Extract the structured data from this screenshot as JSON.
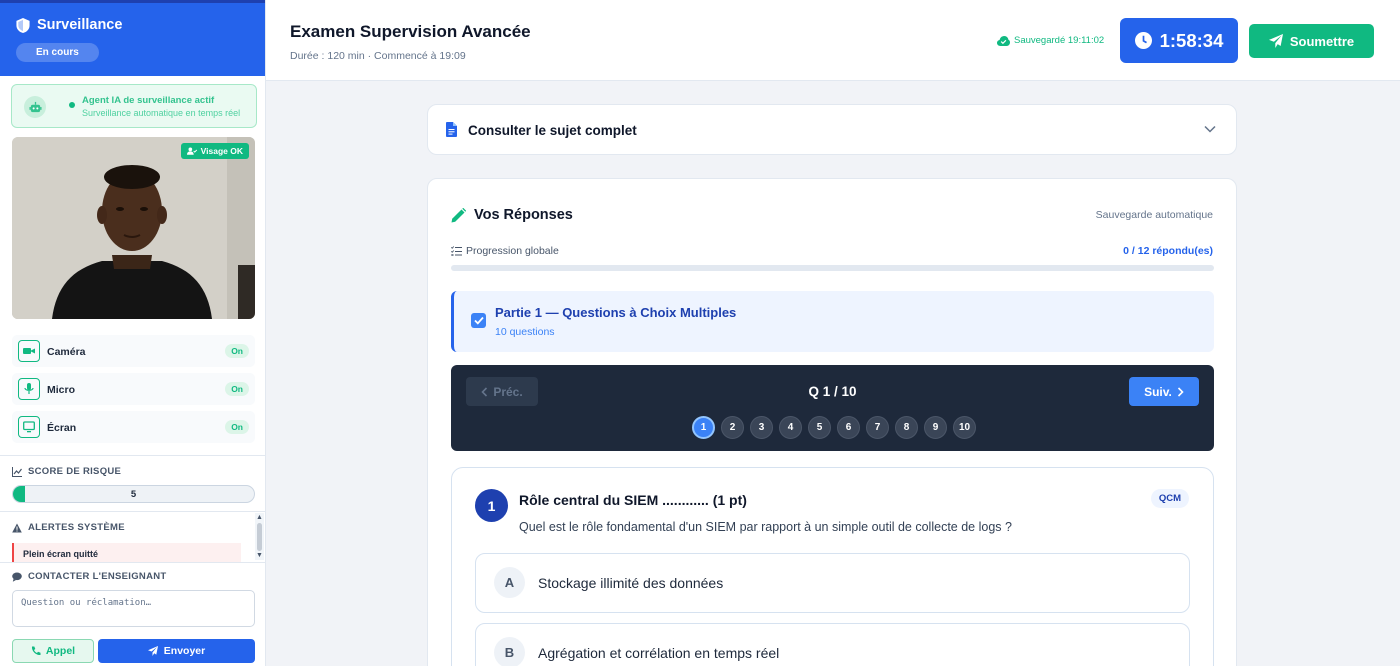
{
  "sidebar": {
    "title": "Surveillance",
    "status": "En cours",
    "agent": {
      "title": "Agent IA de surveillance actif",
      "subtitle": "Surveillance automatique en temps réel"
    },
    "camera_badge": "Visage OK",
    "devices": [
      {
        "label": "Caméra",
        "state": "On",
        "icon": "video-icon"
      },
      {
        "label": "Micro",
        "state": "On",
        "icon": "microphone-icon"
      },
      {
        "label": "Écran",
        "state": "On",
        "icon": "monitor-icon"
      }
    ],
    "risk": {
      "title": "SCORE DE RISQUE",
      "value": "5",
      "fill_percent": 5
    },
    "alerts": {
      "title": "ALERTES SYSTÈME",
      "items": [
        "Plein écran quitté"
      ]
    },
    "contact": {
      "title": "CONTACTER L'ENSEIGNANT",
      "placeholder": "Question ou réclamation…",
      "call_label": "Appel",
      "send_label": "Envoyer"
    }
  },
  "header": {
    "title": "Examen Supervision Avancée",
    "subtitle": "Durée : 120 min · Commencé à 19:09",
    "saved": "Sauvegardé 19:11:02",
    "timer": "1:58:34",
    "submit_label": "Soumettre"
  },
  "subject": {
    "label": "Consulter le sujet complet"
  },
  "answers": {
    "title": "Vos Réponses",
    "auto_save": "Sauvegarde automatique",
    "progress_label": "Progression globale",
    "progress_count": "0 / 12 répondu(es)",
    "progress_fraction": 0,
    "part": {
      "title": "Partie 1 — Questions à Choix Multiples",
      "subtitle": "10 questions"
    },
    "nav": {
      "prev": "Préc.",
      "next": "Suiv.",
      "position": "Q 1 / 10",
      "questions": [
        "1",
        "2",
        "3",
        "4",
        "5",
        "6",
        "7",
        "8",
        "9",
        "10"
      ],
      "active_index": 0
    },
    "question": {
      "number": "1",
      "title": "Rôle central du SIEM ............ (1 pt)",
      "text": "Quel est le rôle fondamental d'un SIEM par rapport à un simple outil de collecte de logs ?",
      "type_badge": "QCM",
      "options": [
        {
          "letter": "A",
          "text": "Stockage illimité des données"
        },
        {
          "letter": "B",
          "text": "Agrégation et corrélation en temps réel"
        }
      ]
    }
  },
  "colors": {
    "primary": "#2563eb",
    "success": "#10b981",
    "danger": "#ef4444",
    "nav_dark": "#1e293b"
  }
}
